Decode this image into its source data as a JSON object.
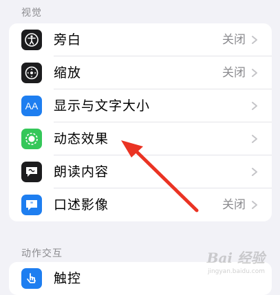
{
  "vision_section": {
    "header": "视觉",
    "rows": [
      {
        "label": "旁白",
        "value": "关闭",
        "icon": "voiceover-icon",
        "icon_color": "#1c1c1e"
      },
      {
        "label": "缩放",
        "value": "关闭",
        "icon": "zoom-icon",
        "icon_color": "#1c1c1e"
      },
      {
        "label": "显示与文字大小",
        "value": "",
        "icon": "text-size-icon",
        "icon_color": "#1e7ef0",
        "icon_text": "AA"
      },
      {
        "label": "动态效果",
        "value": "",
        "icon": "motion-icon",
        "icon_color": "#34c759"
      },
      {
        "label": "朗读内容",
        "value": "",
        "icon": "spoken-content-icon",
        "icon_color": "#1c1c1e"
      },
      {
        "label": "口述影像",
        "value": "关闭",
        "icon": "audio-description-icon",
        "icon_color": "#1e7ef0"
      }
    ]
  },
  "interaction_section": {
    "header": "动作交互",
    "rows": [
      {
        "label": "触控",
        "icon": "touch-icon",
        "icon_color": "#1e7ef0"
      }
    ]
  },
  "annotation": {
    "color": "#ea3323"
  },
  "watermark": {
    "text": "Bai 经验",
    "sub": "jingyan.baidu.com"
  }
}
